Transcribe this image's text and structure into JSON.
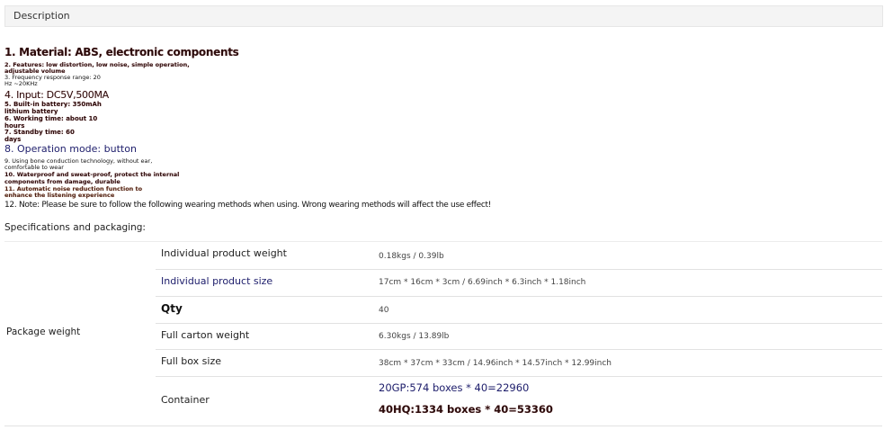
{
  "tab": {
    "label": "Description"
  },
  "features": {
    "f1": "1. Material: ABS, electronic components",
    "f2a": "2. Features: low distortion, low noise, simple operation,",
    "f2b": "adjustable volume",
    "f3a": "3. Frequency response range: 20",
    "f3b": "Hz ~20KHz",
    "f4": "4. Input: DC5V,500MA",
    "f5a": "5. Built-in battery: 350mAh",
    "f5b": "lithium battery",
    "f6a": "6. Working time: about 10",
    "f6b": "hours",
    "f7a": "7. Standby time: 60",
    "f7b": "days",
    "f8": "8. Operation mode: button",
    "f9a": "9. Using bone conduction technology, without ear,",
    "f9b": "comfortable to wear",
    "f10a": "10. Waterproof and sweat-proof, protect the internal",
    "f10b": "components from damage, durable",
    "f11a": "11. Automatic noise reduction function to",
    "f11b": "enhance the listening experience",
    "f12": "12. Note: Please be sure to follow the following wearing methods when using. Wrong wearing methods will affect the use effect!"
  },
  "specs": {
    "title": "Specifications and packaging:",
    "group_label": "Package weight",
    "rows": [
      {
        "label": "Individual product weight",
        "value": "0.18kgs / 0.39lb"
      },
      {
        "label": "Individual product size",
        "value": "17cm * 16cm * 3cm / 6.69inch * 6.3inch * 1.18inch"
      },
      {
        "label": "Qty",
        "value": "40"
      },
      {
        "label": "Full carton weight",
        "value": "6.30kgs / 13.89lb"
      },
      {
        "label": "Full box size",
        "value": "38cm * 37cm * 33cm / 14.96inch * 14.57inch * 12.99inch"
      }
    ],
    "container": {
      "label": "Container",
      "values": [
        "20GP:574 boxes * 40=22960",
        "40HQ:1334 boxes * 40=53360"
      ]
    }
  },
  "colors": {
    "tab_bg": "#f4f4f4",
    "dark_red_text": "#2a0a0a",
    "navy_text": "#1d1d6b",
    "divider": "#e2e2e2"
  }
}
